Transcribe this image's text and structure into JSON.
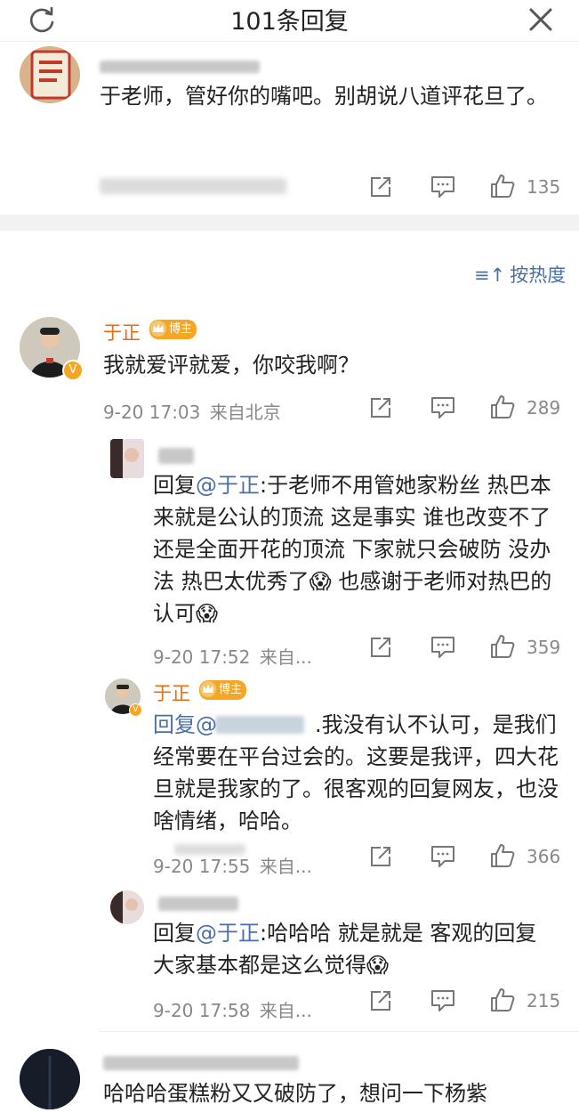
{
  "header": {
    "title": "101条回复"
  },
  "top_comment": {
    "text": "于老师，管好你的嘴吧。别胡说八道评花旦了。",
    "likes": "135"
  },
  "sort_label": "按热度",
  "main_comment": {
    "author": "于正",
    "badge": "博主",
    "text": "我就爱评就爱，你咬我啊？",
    "time": "9-20 17:03",
    "location": "来自北京",
    "likes": "289"
  },
  "replies": [
    {
      "prefix": "回复",
      "mention": "@于正",
      "text": ":于老师不用管她家粉丝 热巴本来就是公认的顶流 这是事实 谁也改变不了 还是全面开花的顶流 下家就只会破防 没办法 热巴太优秀了",
      "text_tail": " 也感谢于老师对热巴的认可",
      "time": "9-20 17:52",
      "location": "来自...",
      "likes": "359"
    },
    {
      "author": "于正",
      "badge": "博主",
      "prefix": "回复@",
      "text": ".我没有认不认可，是我们经常要在平台过会的。这要是我评，四大花旦就是我家的了。很客观的回复网友，也没啥情绪，哈哈。",
      "time": "9-20 17:55",
      "location": "来自...",
      "likes": "366"
    },
    {
      "prefix": "回复",
      "mention": "@于正",
      "text": ":哈哈哈 就是就是 客观的回复 大家基本都是这么觉得",
      "time": "9-20 17:58",
      "location": "来自...",
      "likes": "215"
    }
  ],
  "bottom_comment": {
    "text": "哈哈哈蛋糕粉又又破防了，想问一下杨紫"
  }
}
